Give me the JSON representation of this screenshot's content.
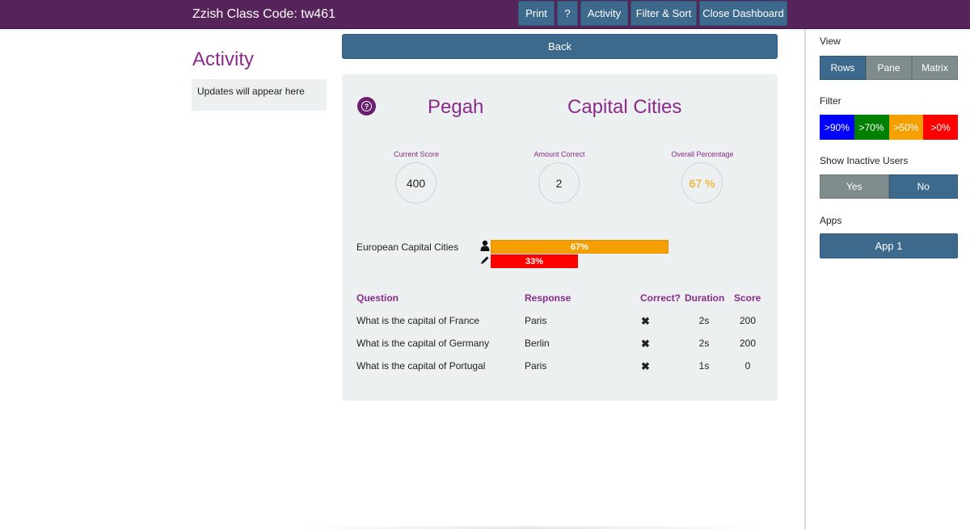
{
  "header": {
    "class_code": "Zzish Class Code: tw461",
    "buttons": [
      "Print",
      "?",
      "Activity",
      "Filter & Sort",
      "Close Dashboard"
    ]
  },
  "activity": {
    "title": "Activity",
    "updates": "Updates will appear here"
  },
  "main": {
    "back_label": "Back",
    "student": "Pegah",
    "quiz": "Capital Cities",
    "stats": [
      {
        "label": "Current Score",
        "value": "400"
      },
      {
        "label": "Amount Correct",
        "value": "2"
      },
      {
        "label": "Overall Percentage",
        "value": "67 %"
      }
    ],
    "topic": {
      "name": "European Capital Cities",
      "user_bar": {
        "label": "67%",
        "fraction": 0.67
      },
      "pencil_bar": {
        "label": "33%",
        "fraction": 0.33
      }
    },
    "table": {
      "headers": [
        "Question",
        "Response",
        "Correct?",
        "Duration",
        "Score"
      ],
      "rows": [
        {
          "question": "What is the capital of France",
          "response": "Paris",
          "correct": "✖",
          "duration": "2s",
          "score": "200"
        },
        {
          "question": "What is the capital of Germany",
          "response": "Berlin",
          "correct": "✖",
          "duration": "2s",
          "score": "200"
        },
        {
          "question": "What is the capital of Portugal",
          "response": "Paris",
          "correct": "✖",
          "duration": "1s",
          "score": "0"
        }
      ]
    }
  },
  "sidebar": {
    "view_heading": "View",
    "view_options": [
      "Rows",
      "Pane",
      "Matrix"
    ],
    "view_selected": "Rows",
    "filter_heading": "Filter",
    "filter_options": [
      {
        "label": ">90%",
        "color": "#0000ff"
      },
      {
        "label": ">70%",
        "color": "#008000"
      },
      {
        "label": ">50%",
        "color": "#f5a000"
      },
      {
        "label": ">0%",
        "color": "#ff0000"
      }
    ],
    "inactive_heading": "Show Inactive Users",
    "inactive_options": [
      "Yes",
      "No"
    ],
    "inactive_selected": "No",
    "apps_heading": "Apps",
    "apps": [
      "App 1"
    ]
  },
  "colors": {
    "header_bg": "#56245a",
    "button_blue": "#3d6a8c",
    "accent_purple": "#8a2a8a",
    "inactive_gray": "#7f8c8d"
  }
}
